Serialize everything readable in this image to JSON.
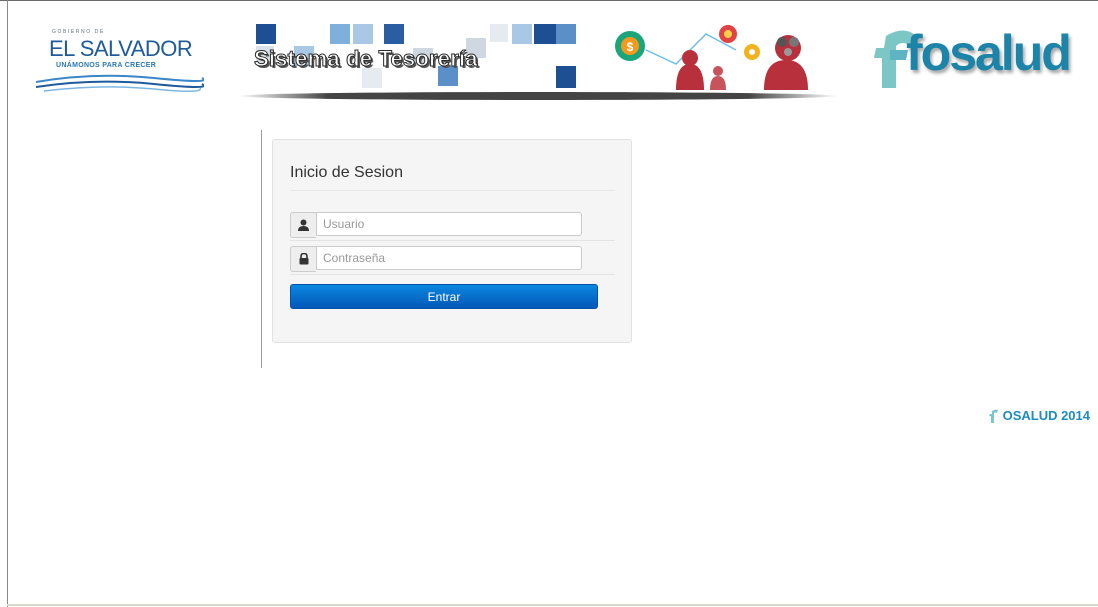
{
  "header": {
    "gov_logo": {
      "small_text": "GOBIERNO DE",
      "main_text": "EL SALVADOR",
      "tagline": "UNÁMONOS PARA CRECER"
    },
    "banner_title": "Sistema de Tesorería",
    "brand_logo_text": "fosalud"
  },
  "login": {
    "title": "Inicio de Sesion",
    "username": {
      "placeholder": "Usuario",
      "value": "",
      "icon": "user-icon"
    },
    "password": {
      "placeholder": "Contraseña",
      "value": "",
      "icon": "lock-icon"
    },
    "submit_label": "Entrar"
  },
  "footer": {
    "brand": "OSALUD 2014",
    "icon": "fosalud-mini-icon"
  },
  "colors": {
    "primary_button": "#0a70d0",
    "brand_teal": "#1b84a8",
    "footer_text": "#1d8cc0"
  }
}
